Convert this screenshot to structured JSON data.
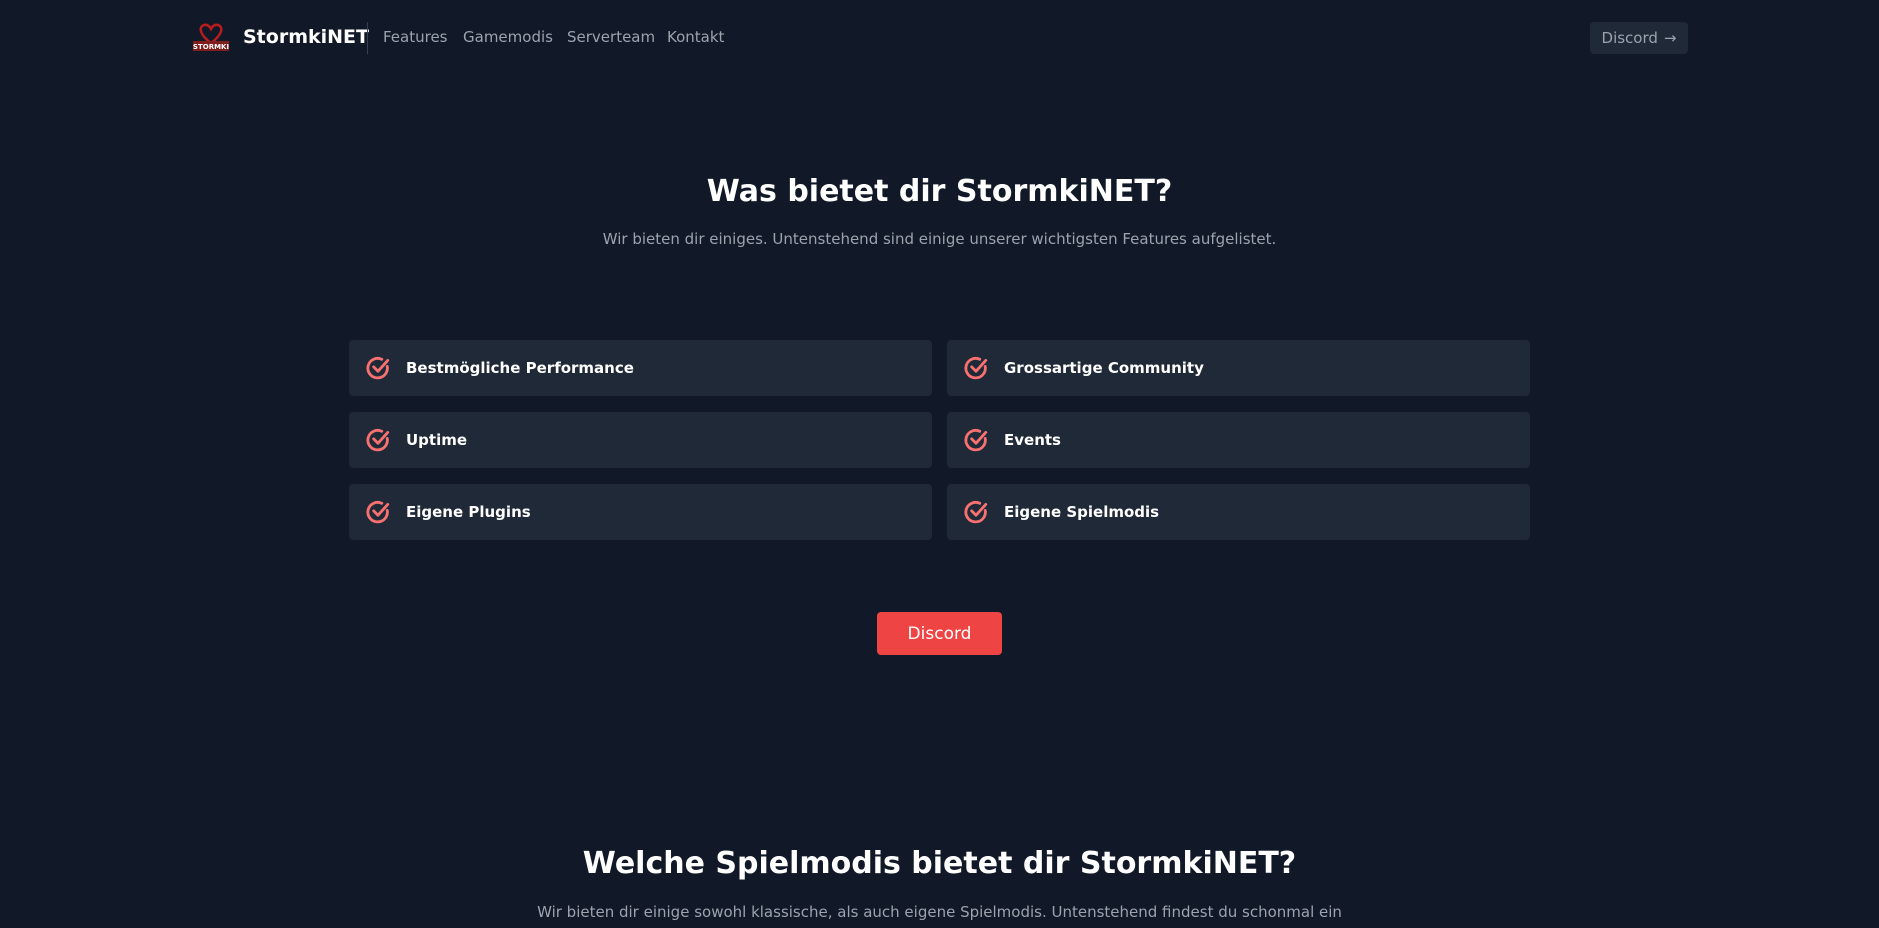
{
  "nav": {
    "brand": "StormkiNET",
    "logo_text": "STORMKI",
    "links": [
      "Features",
      "Gamemodis",
      "Serverteam",
      "Kontakt"
    ],
    "discord_label": "Discord",
    "discord_icon": "arrow-right-icon"
  },
  "features": {
    "title": "Was bietet dir StormkiNET?",
    "subtitle": "Wir bieten dir einiges. Untenstehend sind einige unserer wichtigsten Features aufgelistet.",
    "items": [
      "Bestmögliche Performance",
      "Grossartige Community",
      "Uptime",
      "Events",
      "Eigene Plugins",
      "Eigene Spielmodis"
    ],
    "icon": "check-circle-icon",
    "button_label": "Discord"
  },
  "gamemodes": {
    "title": "Welche Spielmodis bietet dir StormkiNET?",
    "subtitle": "Wir bieten dir einige sowohl klassische, als auch eigene Spielmodis. Untenstehend findest du schonmal ein"
  },
  "colors": {
    "background": "#111827",
    "card": "#1f2937",
    "accent": "#ef4444",
    "icon": "#f87171"
  }
}
